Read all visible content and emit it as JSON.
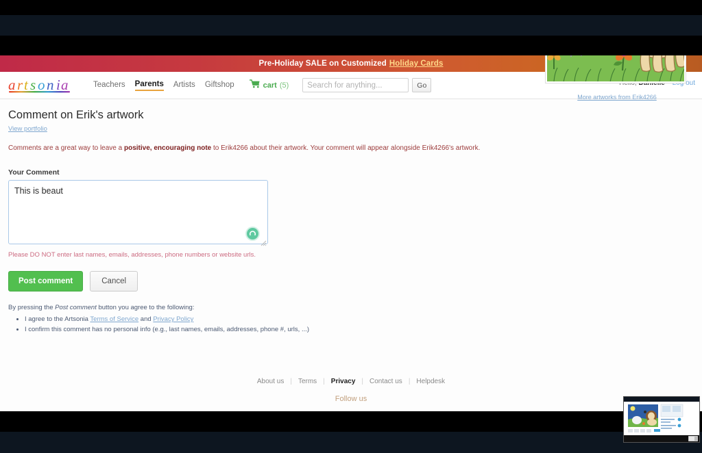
{
  "promo": {
    "text": "Pre-Holiday SALE on Customized",
    "link_label": "Holiday Cards"
  },
  "header": {
    "logo_text": "artsonia",
    "nav": [
      {
        "label": "Teachers",
        "active": false
      },
      {
        "label": "Parents",
        "active": true
      },
      {
        "label": "Artists",
        "active": false
      },
      {
        "label": "Giftshop",
        "active": false
      }
    ],
    "cart": {
      "icon": "shopping-cart-icon",
      "label": "cart",
      "count": "(5)"
    },
    "search": {
      "placeholder": "Search for anything...",
      "value": "",
      "button_label": "Go"
    },
    "user": {
      "greeting": "Hello,",
      "name": "Danielle",
      "logout_label": "Log out"
    }
  },
  "main": {
    "page_title": "Comment on Erik's artwork",
    "portfolio_link": "View portfolio",
    "intro_part1": "Comments are a great way to leave a ",
    "intro_bold": "positive, encouraging note",
    "intro_part2": " to Erik4266 about their artwork. Your comment will appear alongside Erik4266's artwork.",
    "comment_label": "Your Comment",
    "comment_value": "This is beaut",
    "comment_placeholder": "",
    "warning": "Please DO NOT enter last names, emails, addresses, phone numbers or website urls.",
    "post_button": "Post comment",
    "cancel_button": "Cancel",
    "agree_intro_a": "By pressing the ",
    "agree_intro_em": "Post comment",
    "agree_intro_b": " button you agree to the following:",
    "agree_items": [
      {
        "pre": "I agree to the Artsonia ",
        "link1": "Terms of Service",
        "mid": " and ",
        "link2": "Privacy Policy",
        "post": ""
      },
      {
        "pre": "I confirm this comment has no personal info (e.g., last names, emails, addresses, phone #, urls, ...)",
        "link1": "",
        "mid": "",
        "link2": "",
        "post": ""
      }
    ],
    "artwork_alt": "Watercolor painting of a lion, sheep, sun, clouds, a bee and a flower in a grassy field",
    "more_artworks_link": "More artworks from Erik4266"
  },
  "footer": {
    "links": [
      {
        "label": "About us",
        "bold": false
      },
      {
        "label": "Terms",
        "bold": false
      },
      {
        "label": "Privacy",
        "bold": true
      },
      {
        "label": "Contact us",
        "bold": false
      },
      {
        "label": "Helpdesk",
        "bold": false
      }
    ],
    "follow_us": "Follow us"
  },
  "colors": {
    "promo_start": "#c02a48",
    "promo_end": "#b85b22",
    "post_button": "#52bf4f",
    "cart_green": "#4aab4f",
    "link_blue": "#7fa7cf",
    "warning_red": "#cc6b81",
    "nav_active_underline": "#e8a33d"
  }
}
